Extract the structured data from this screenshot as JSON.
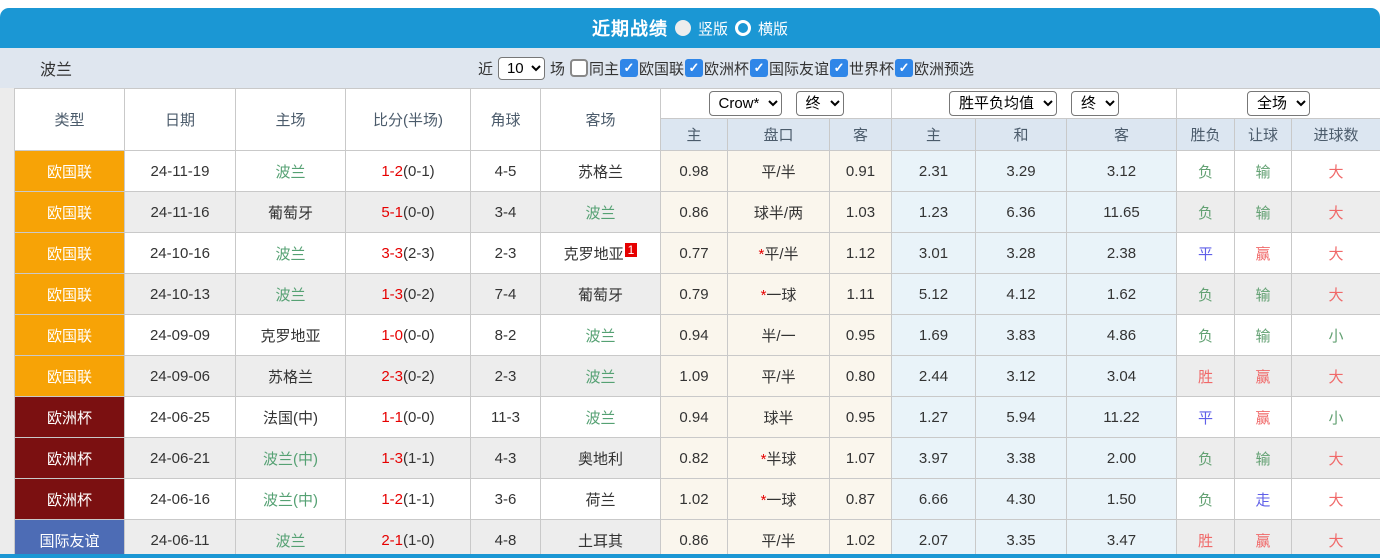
{
  "colors": {
    "accent": "#1b97d4",
    "badge_orange": "#f7a306",
    "badge_maroon": "#7b1011",
    "badge_blue": "#4d6cb5",
    "team_green": "#55a173",
    "score_red": "#e60000",
    "result_red": "#f06969",
    "result_green": "#63a173",
    "result_blue": "#5f5fe8",
    "handicap_col_bg": "#faf6ed",
    "avg_col_bg": "#e9f3f9"
  },
  "titlebar": {
    "title": "近期战绩",
    "radios": [
      {
        "label": "竖版",
        "selected": true
      },
      {
        "label": "横版",
        "selected": false
      }
    ]
  },
  "filter": {
    "team": "波兰",
    "recent_label_left": "近",
    "recent_count": "10",
    "recent_label_right": "场",
    "checkboxes": [
      {
        "label": "同主",
        "checked": false
      },
      {
        "label": "欧国联",
        "checked": true
      },
      {
        "label": "欧洲杯",
        "checked": true
      },
      {
        "label": "国际友谊",
        "checked": true
      },
      {
        "label": "世界杯",
        "checked": true
      },
      {
        "label": "欧洲预选",
        "checked": true
      }
    ]
  },
  "table": {
    "selects": {
      "bookmaker": "Crow*",
      "bookmaker_state": "终",
      "avg": "胜平负均值",
      "avg_state": "终",
      "scope": "全场"
    },
    "headers_left": [
      "类型",
      "日期",
      "主场",
      "比分(半场)",
      "角球",
      "客场"
    ],
    "headers_odds": [
      "主",
      "盘口",
      "客"
    ],
    "headers_avg": [
      "主",
      "和",
      "客"
    ],
    "headers_result": [
      "胜负",
      "让球",
      "进球数"
    ],
    "rows": [
      {
        "type": "欧国联",
        "tc": "orange",
        "date": "24-11-19",
        "home": "波兰",
        "hg": true,
        "score": "1-2",
        "half": "(0-1)",
        "corner": "4-5",
        "away": "苏格兰",
        "ag": false,
        "badge": "",
        "oh": "0.98",
        "star": false,
        "hc": "平/半",
        "oa": "0.91",
        "ah": "2.31",
        "ad": "3.29",
        "aa": "3.12",
        "r1": {
          "t": "负",
          "c": "green"
        },
        "r2": {
          "t": "输",
          "c": "green"
        },
        "r3": {
          "t": "大",
          "c": "red"
        }
      },
      {
        "type": "欧国联",
        "tc": "orange",
        "date": "24-11-16",
        "home": "葡萄牙",
        "hg": false,
        "score": "5-1",
        "half": "(0-0)",
        "corner": "3-4",
        "away": "波兰",
        "ag": true,
        "badge": "",
        "oh": "0.86",
        "star": false,
        "hc": "球半/两",
        "oa": "1.03",
        "ah": "1.23",
        "ad": "6.36",
        "aa": "11.65",
        "r1": {
          "t": "负",
          "c": "green"
        },
        "r2": {
          "t": "输",
          "c": "green"
        },
        "r3": {
          "t": "大",
          "c": "red"
        }
      },
      {
        "type": "欧国联",
        "tc": "orange",
        "date": "24-10-16",
        "home": "波兰",
        "hg": true,
        "score": "3-3",
        "half": "(2-3)",
        "corner": "2-3",
        "away": "克罗地亚",
        "ag": false,
        "badge": "1",
        "oh": "0.77",
        "star": true,
        "hc": "平/半",
        "oa": "1.12",
        "ah": "3.01",
        "ad": "3.28",
        "aa": "2.38",
        "r1": {
          "t": "平",
          "c": "blue"
        },
        "r2": {
          "t": "赢",
          "c": "red"
        },
        "r3": {
          "t": "大",
          "c": "red"
        }
      },
      {
        "type": "欧国联",
        "tc": "orange",
        "date": "24-10-13",
        "home": "波兰",
        "hg": true,
        "score": "1-3",
        "half": "(0-2)",
        "corner": "7-4",
        "away": "葡萄牙",
        "ag": false,
        "badge": "",
        "oh": "0.79",
        "star": true,
        "hc": "一球",
        "oa": "1.11",
        "ah": "5.12",
        "ad": "4.12",
        "aa": "1.62",
        "r1": {
          "t": "负",
          "c": "green"
        },
        "r2": {
          "t": "输",
          "c": "green"
        },
        "r3": {
          "t": "大",
          "c": "red"
        }
      },
      {
        "type": "欧国联",
        "tc": "orange",
        "date": "24-09-09",
        "home": "克罗地亚",
        "hg": false,
        "score": "1-0",
        "half": "(0-0)",
        "corner": "8-2",
        "away": "波兰",
        "ag": true,
        "badge": "",
        "oh": "0.94",
        "star": false,
        "hc": "半/一",
        "oa": "0.95",
        "ah": "1.69",
        "ad": "3.83",
        "aa": "4.86",
        "r1": {
          "t": "负",
          "c": "green"
        },
        "r2": {
          "t": "输",
          "c": "green"
        },
        "r3": {
          "t": "小",
          "c": "green"
        }
      },
      {
        "type": "欧国联",
        "tc": "orange",
        "date": "24-09-06",
        "home": "苏格兰",
        "hg": false,
        "score": "2-3",
        "half": "(0-2)",
        "corner": "2-3",
        "away": "波兰",
        "ag": true,
        "badge": "",
        "oh": "1.09",
        "star": false,
        "hc": "平/半",
        "oa": "0.80",
        "ah": "2.44",
        "ad": "3.12",
        "aa": "3.04",
        "r1": {
          "t": "胜",
          "c": "red"
        },
        "r2": {
          "t": "赢",
          "c": "red"
        },
        "r3": {
          "t": "大",
          "c": "red"
        }
      },
      {
        "type": "欧洲杯",
        "tc": "maroon",
        "date": "24-06-25",
        "home": "法国(中)",
        "hg": false,
        "score": "1-1",
        "half": "(0-0)",
        "corner": "11-3",
        "away": "波兰",
        "ag": true,
        "badge": "",
        "oh": "0.94",
        "star": false,
        "hc": "球半",
        "oa": "0.95",
        "ah": "1.27",
        "ad": "5.94",
        "aa": "11.22",
        "r1": {
          "t": "平",
          "c": "blue"
        },
        "r2": {
          "t": "赢",
          "c": "red"
        },
        "r3": {
          "t": "小",
          "c": "green"
        }
      },
      {
        "type": "欧洲杯",
        "tc": "maroon",
        "date": "24-06-21",
        "home": "波兰(中)",
        "hg": true,
        "score": "1-3",
        "half": "(1-1)",
        "corner": "4-3",
        "away": "奥地利",
        "ag": false,
        "badge": "",
        "oh": "0.82",
        "star": true,
        "hc": "半球",
        "oa": "1.07",
        "ah": "3.97",
        "ad": "3.38",
        "aa": "2.00",
        "r1": {
          "t": "负",
          "c": "green"
        },
        "r2": {
          "t": "输",
          "c": "green"
        },
        "r3": {
          "t": "大",
          "c": "red"
        }
      },
      {
        "type": "欧洲杯",
        "tc": "maroon",
        "date": "24-06-16",
        "home": "波兰(中)",
        "hg": true,
        "score": "1-2",
        "half": "(1-1)",
        "corner": "3-6",
        "away": "荷兰",
        "ag": false,
        "badge": "",
        "oh": "1.02",
        "star": true,
        "hc": "一球",
        "oa": "0.87",
        "ah": "6.66",
        "ad": "4.30",
        "aa": "1.50",
        "r1": {
          "t": "负",
          "c": "green"
        },
        "r2": {
          "t": "走",
          "c": "blue"
        },
        "r3": {
          "t": "大",
          "c": "red"
        }
      },
      {
        "type": "国际友谊",
        "tc": "blue",
        "date": "24-06-11",
        "home": "波兰",
        "hg": true,
        "score": "2-1",
        "half": "(1-0)",
        "corner": "4-8",
        "away": "土耳其",
        "ag": false,
        "badge": "",
        "oh": "0.86",
        "star": false,
        "hc": "平/半",
        "oa": "1.02",
        "ah": "2.07",
        "ad": "3.35",
        "aa": "3.47",
        "r1": {
          "t": "胜",
          "c": "red"
        },
        "r2": {
          "t": "赢",
          "c": "red"
        },
        "r3": {
          "t": "大",
          "c": "red"
        }
      }
    ]
  }
}
